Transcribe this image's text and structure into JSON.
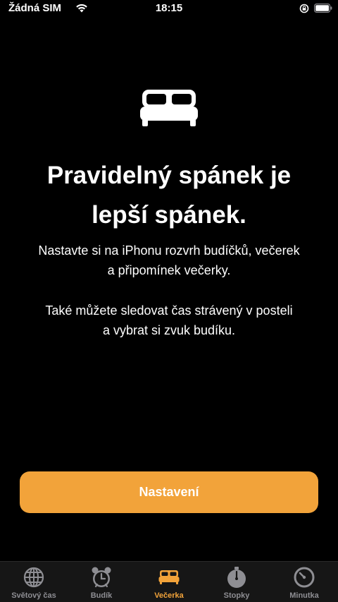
{
  "status_bar": {
    "carrier": "Žádná SIM",
    "time": "18:15"
  },
  "hero": {
    "icon": "bed-icon",
    "headline_line1": "Pravidelný spánek je",
    "headline_line2": "lepší spánek.",
    "paragraph1_line1": "Nastavte si na iPhonu rozvrh budíčků, večerek",
    "paragraph1_line2": "a připomínek večerky.",
    "paragraph2_line1": "Také můžete sledovat čas strávený v posteli",
    "paragraph2_line2": "a vybrat si zvuk budíku."
  },
  "setup_button": {
    "label": "Nastavení"
  },
  "tab_bar": {
    "tabs": [
      {
        "label": "Světový čas",
        "icon": "globe-icon",
        "active": false
      },
      {
        "label": "Budík",
        "icon": "alarm-clock-icon",
        "active": false
      },
      {
        "label": "Večerka",
        "icon": "bed-icon",
        "active": true
      },
      {
        "label": "Stopky",
        "icon": "stopwatch-icon",
        "active": false
      },
      {
        "label": "Minutka",
        "icon": "timer-icon",
        "active": false
      }
    ]
  },
  "colors": {
    "accent": "#f2a33a",
    "background": "#000000",
    "tab_bar_background": "#161616",
    "inactive_tab": "#8e8e93"
  }
}
